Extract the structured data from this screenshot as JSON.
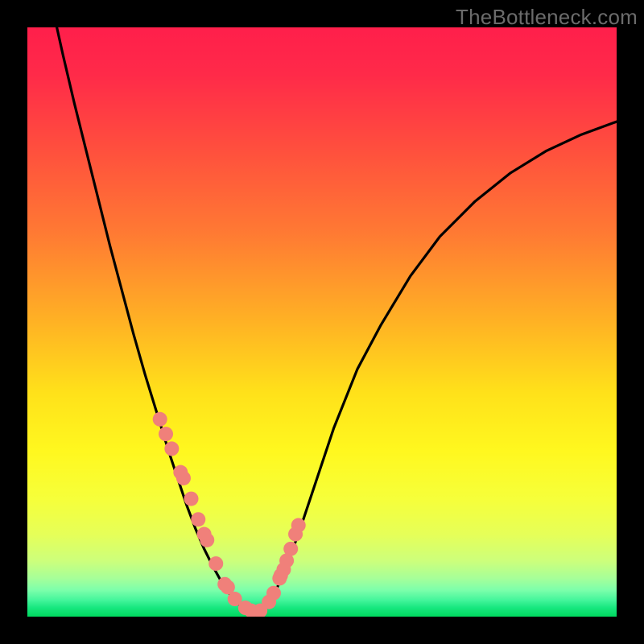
{
  "watermark": "TheBottleneck.com",
  "colors": {
    "frame": "#000000",
    "curve": "#000000",
    "marker_fill": "#f0807a",
    "marker_stroke": "#d95a56",
    "gradient_stops": [
      {
        "offset": 0,
        "color": "#ff1f4b"
      },
      {
        "offset": 0.08,
        "color": "#ff2a49"
      },
      {
        "offset": 0.2,
        "color": "#ff4d3e"
      },
      {
        "offset": 0.35,
        "color": "#ff7a33"
      },
      {
        "offset": 0.5,
        "color": "#ffb224"
      },
      {
        "offset": 0.62,
        "color": "#ffe11a"
      },
      {
        "offset": 0.72,
        "color": "#fff81f"
      },
      {
        "offset": 0.8,
        "color": "#f6ff3a"
      },
      {
        "offset": 0.86,
        "color": "#e6ff58"
      },
      {
        "offset": 0.905,
        "color": "#cdff7b"
      },
      {
        "offset": 0.935,
        "color": "#a6ff99"
      },
      {
        "offset": 0.955,
        "color": "#7cffab"
      },
      {
        "offset": 0.972,
        "color": "#44f59b"
      },
      {
        "offset": 0.985,
        "color": "#17e77e"
      },
      {
        "offset": 1.0,
        "color": "#00d95f"
      }
    ]
  },
  "chart_data": {
    "type": "line",
    "title": "",
    "xlabel": "",
    "ylabel": "",
    "xlim": [
      0,
      1
    ],
    "ylim": [
      0,
      1
    ],
    "series": [
      {
        "name": "bottleneck-curve",
        "x": [
          0.05,
          0.06,
          0.08,
          0.1,
          0.12,
          0.14,
          0.16,
          0.18,
          0.2,
          0.22,
          0.24,
          0.255,
          0.27,
          0.285,
          0.3,
          0.315,
          0.33,
          0.345,
          0.36,
          0.375,
          0.39,
          0.405,
          0.42,
          0.435,
          0.46,
          0.49,
          0.52,
          0.56,
          0.6,
          0.65,
          0.7,
          0.76,
          0.82,
          0.88,
          0.94,
          1.0
        ],
        "y": [
          1.0,
          0.955,
          0.87,
          0.79,
          0.71,
          0.63,
          0.555,
          0.48,
          0.41,
          0.345,
          0.28,
          0.235,
          0.19,
          0.15,
          0.115,
          0.085,
          0.058,
          0.036,
          0.02,
          0.01,
          0.01,
          0.02,
          0.04,
          0.075,
          0.14,
          0.23,
          0.32,
          0.42,
          0.495,
          0.578,
          0.645,
          0.705,
          0.753,
          0.79,
          0.818,
          0.84
        ]
      }
    ],
    "markers": {
      "name": "sample-points",
      "x": [
        0.225,
        0.235,
        0.245,
        0.26,
        0.265,
        0.278,
        0.29,
        0.3,
        0.305,
        0.32,
        0.335,
        0.34,
        0.352,
        0.37,
        0.38,
        0.395,
        0.41,
        0.418,
        0.428,
        0.43,
        0.435,
        0.44,
        0.447,
        0.455,
        0.46
      ],
      "y": [
        0.335,
        0.31,
        0.285,
        0.245,
        0.235,
        0.2,
        0.165,
        0.14,
        0.13,
        0.09,
        0.055,
        0.05,
        0.03,
        0.015,
        0.01,
        0.01,
        0.025,
        0.04,
        0.065,
        0.07,
        0.08,
        0.095,
        0.115,
        0.14,
        0.155
      ]
    }
  }
}
